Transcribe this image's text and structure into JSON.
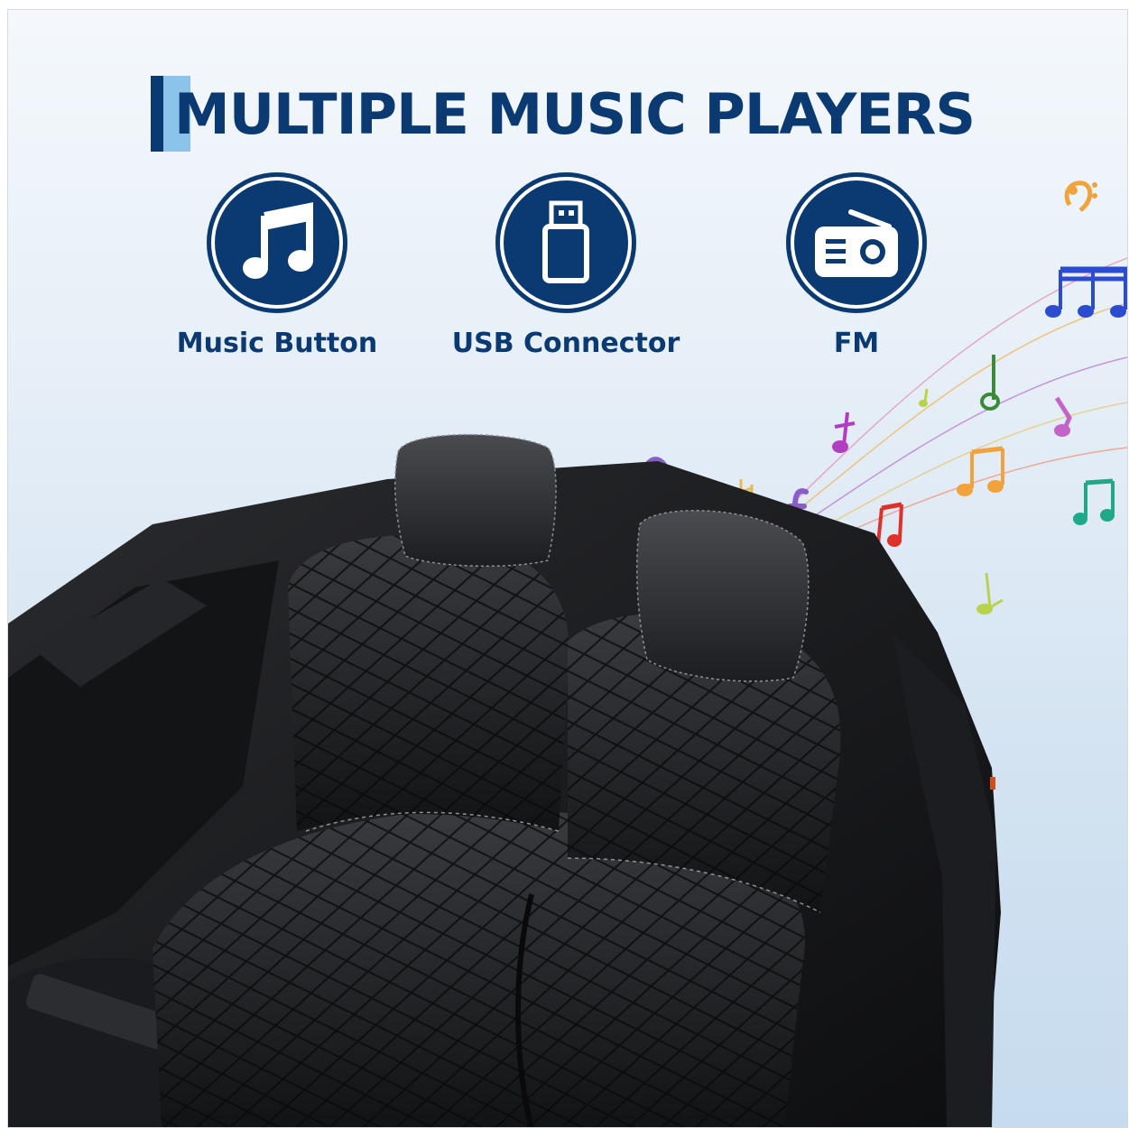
{
  "title": "MULTIPLE MUSIC PLAYERS",
  "features": [
    {
      "icon": "music-note-icon",
      "label": "Music Button"
    },
    {
      "icon": "usb-drive-icon",
      "label": "USB Connector"
    },
    {
      "icon": "radio-icon",
      "label": "FM"
    }
  ],
  "colors": {
    "navy": "#0b3a72",
    "accent_light_blue": "#8cc3ea",
    "background": "#dde9f4",
    "seat_black": "#1a1b1d"
  },
  "photo": {
    "subject": "black ride-on car two-seat interior"
  },
  "decor": {
    "notes_colors": [
      "#f2a23a",
      "#2b4bd0",
      "#8a5cc8",
      "#b13ec2",
      "#6bbf3a",
      "#e0302a",
      "#20a88a",
      "#cfa0d8"
    ]
  }
}
